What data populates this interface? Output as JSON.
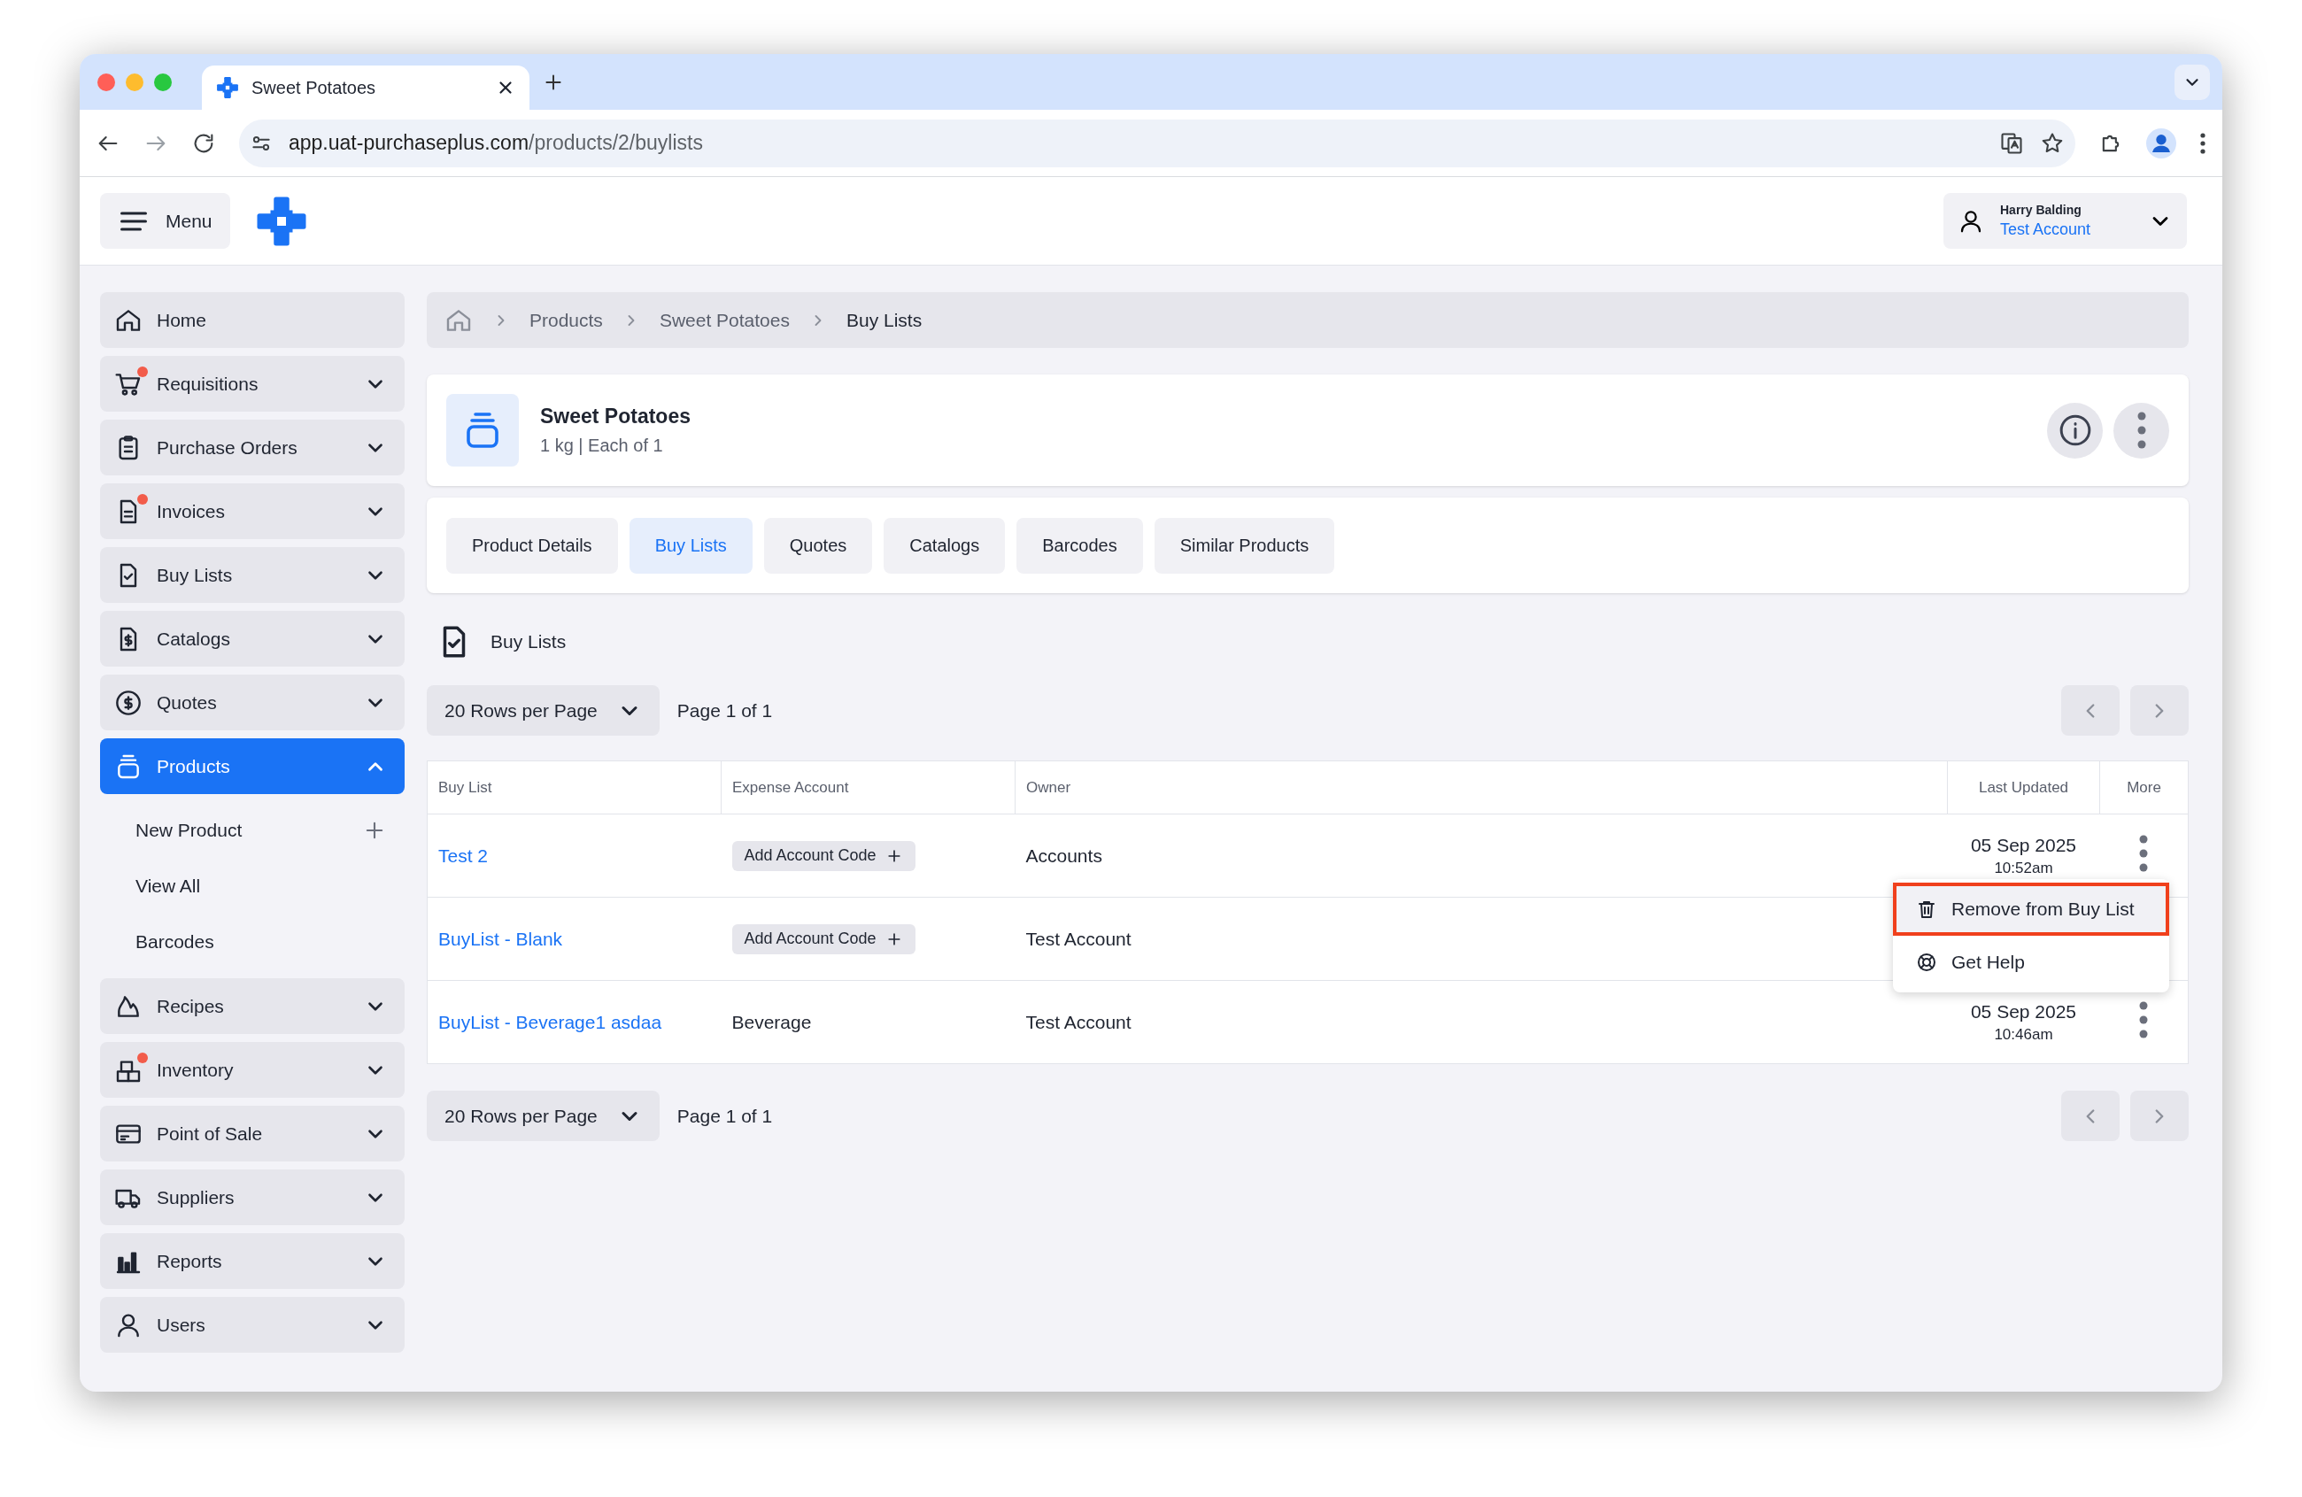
{
  "browser": {
    "tab_title": "Sweet Potatoes",
    "url_host": "app.uat-purchaseplus.com",
    "url_path": "/products/2/buylists"
  },
  "header": {
    "menu_label": "Menu",
    "user_name": "Harry Balding",
    "account": "Test Account"
  },
  "sidebar": {
    "items": [
      {
        "label": "Home",
        "badge": false,
        "selected": false
      },
      {
        "label": "Requisitions",
        "badge": true,
        "expanded": false,
        "selected": false
      },
      {
        "label": "Purchase Orders",
        "badge": false,
        "expanded": false,
        "selected": false
      },
      {
        "label": "Invoices",
        "badge": true,
        "expanded": false,
        "selected": false
      },
      {
        "label": "Buy Lists",
        "badge": false,
        "expanded": false,
        "selected": false
      },
      {
        "label": "Catalogs",
        "badge": false,
        "expanded": false,
        "selected": false
      },
      {
        "label": "Quotes",
        "badge": false,
        "expanded": false,
        "selected": false
      },
      {
        "label": "Products",
        "badge": false,
        "expanded": true,
        "selected": true,
        "children": [
          {
            "label": "New Product",
            "kind": "add"
          },
          {
            "label": "View All",
            "kind": "link"
          },
          {
            "label": "Barcodes",
            "kind": "link"
          }
        ]
      },
      {
        "label": "Recipes",
        "badge": false,
        "expanded": false,
        "selected": false
      },
      {
        "label": "Inventory",
        "badge": true,
        "expanded": false,
        "selected": false
      },
      {
        "label": "Point of Sale",
        "badge": false,
        "expanded": false,
        "selected": false
      },
      {
        "label": "Suppliers",
        "badge": false,
        "expanded": false,
        "selected": false
      },
      {
        "label": "Reports",
        "badge": false,
        "expanded": false,
        "selected": false
      },
      {
        "label": "Users",
        "badge": false,
        "expanded": false,
        "selected": false
      }
    ]
  },
  "breadcrumb": [
    "Products",
    "Sweet Potatoes",
    "Buy Lists"
  ],
  "product": {
    "title": "Sweet Potatoes",
    "details": "1 kg | Each of 1"
  },
  "tabs": [
    {
      "label": "Product Details",
      "selected": false
    },
    {
      "label": "Buy Lists",
      "selected": true
    },
    {
      "label": "Quotes",
      "selected": false
    },
    {
      "label": "Catalogs",
      "selected": false
    },
    {
      "label": "Barcodes",
      "selected": false
    },
    {
      "label": "Similar Products",
      "selected": false
    }
  ],
  "section_title": "Buy Lists",
  "pagination_top": {
    "rows_per_page": "20 Rows per Page",
    "page": "Page 1 of 1"
  },
  "table": {
    "columns": [
      "Buy List",
      "Expense Account",
      "Owner",
      "Last Updated",
      "More"
    ],
    "rows": [
      {
        "buy_list": "Test 2",
        "expense": {
          "kind": "button",
          "label": "Add Account Code"
        },
        "owner": "Accounts",
        "date": "05 Sep 2025",
        "time": "10:52am"
      },
      {
        "buy_list": "BuyList - Blank",
        "expense": {
          "kind": "button",
          "label": "Add Account Code"
        },
        "owner": "Test Account"
      },
      {
        "buy_list": "BuyList - Beverage1 asdaa",
        "expense": {
          "kind": "text",
          "label": "Beverage"
        },
        "owner": "Test Account",
        "date": "05 Sep 2025",
        "time": "10:46am"
      }
    ],
    "menu": {
      "items": [
        {
          "label": "Remove from Buy List",
          "highlighted": true
        },
        {
          "label": "Get Help",
          "highlighted": false
        }
      ]
    }
  },
  "pagination_bottom": {
    "rows_per_page": "20 Rows per Page",
    "page": "Page 1 of 1"
  }
}
